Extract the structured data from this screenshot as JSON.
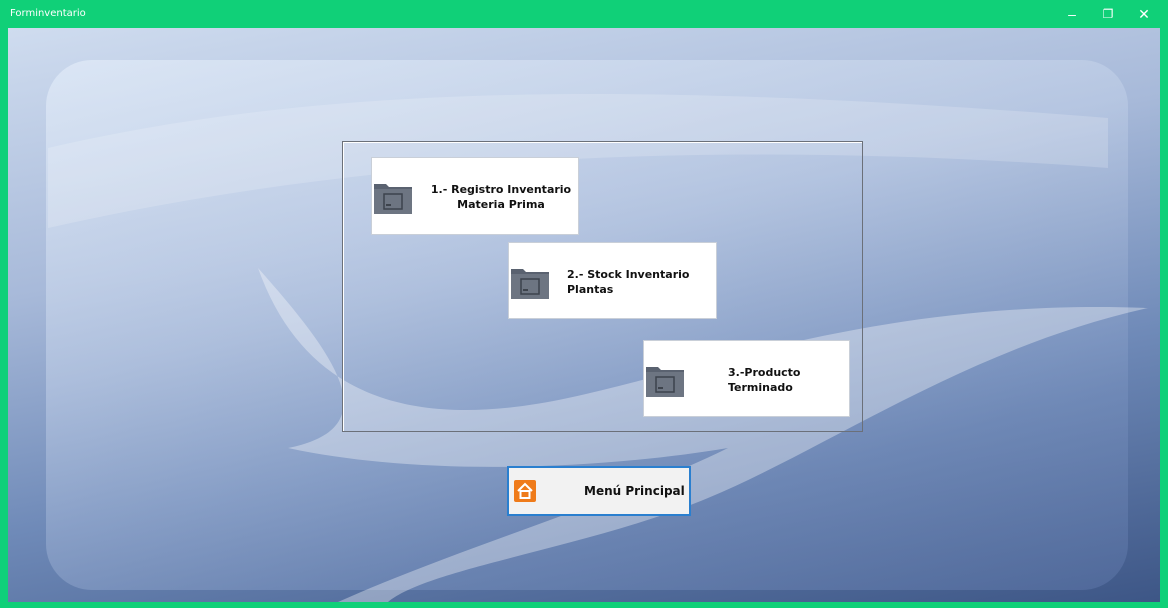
{
  "window": {
    "title": "Forminventario",
    "minimize": "–",
    "restore": "❐",
    "close": "✕",
    "accent": "#10d078"
  },
  "tiles": [
    {
      "label": "1.- Registro Inventario\n Materia Prima",
      "icon": "folder-icon"
    },
    {
      "label": "2.-  Stock Inventario\n     Plantas",
      "icon": "folder-icon"
    },
    {
      "label": "3.-Producto\nTerminado",
      "icon": "folder-icon"
    }
  ],
  "menu_button": {
    "label": "Menú Principal",
    "icon": "home-icon",
    "accent": "#ef7b1a"
  }
}
